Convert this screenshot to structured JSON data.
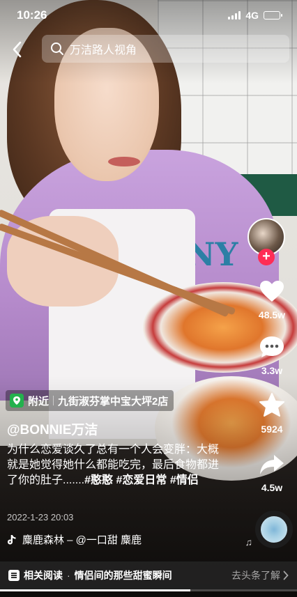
{
  "status_bar": {
    "time": "10:26",
    "network": "4G"
  },
  "search": {
    "placeholder": "万洁路人视角"
  },
  "actions": {
    "like_count": "48.5w",
    "comment_count": "3.3w",
    "favorite_count": "5924",
    "share_count": "4.5w"
  },
  "location": {
    "prefix": "附近",
    "name": "九街淑芬掌中宝大坪2店"
  },
  "post": {
    "author": "@BONNIE万洁",
    "caption_text": "为什么恋爱谈久了总有一个人会变胖：大概就是她觉得她什么都能吃完，最后食物都进了你的肚子.......",
    "hashtags": [
      "#憨憨",
      "#恋爱日常",
      "#情侣"
    ],
    "date": "2022-1-23 20:03"
  },
  "music": {
    "text": "麋鹿森林 – @一口甜   麋鹿"
  },
  "related": {
    "label": "相关阅读",
    "separator": "·",
    "title": "情侣间的那些甜蜜瞬间",
    "link": "去头条了解"
  },
  "playback": {
    "progress": 0.64
  },
  "colors": {
    "follow": "#ff2d55",
    "location_pin": "#23b14d"
  }
}
